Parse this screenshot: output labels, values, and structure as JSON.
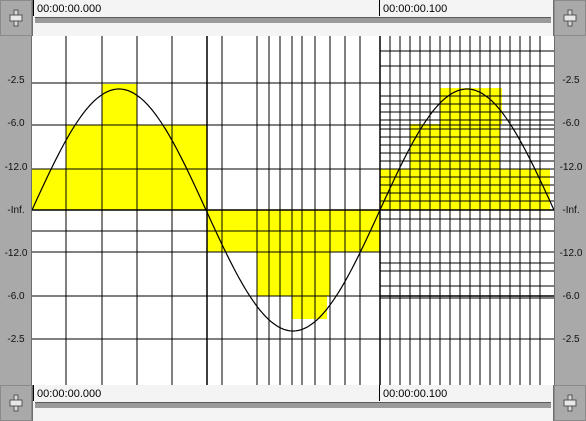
{
  "ruler": {
    "start_time": "00:00:00.000",
    "mid_time": "00:00:00.100"
  },
  "db_scale": [
    "-2.5",
    "-6.0",
    "-12.0",
    "-Inf.",
    "-12.0",
    "-6.0",
    "-2.5"
  ],
  "colors": {
    "grid": "#000000",
    "fill": "#ffff00",
    "background": "#ffffff",
    "frame": "#c0c0c0"
  },
  "icons": {
    "left_handle": "marker-handle-icon",
    "right_handle": "marker-handle-icon"
  }
}
